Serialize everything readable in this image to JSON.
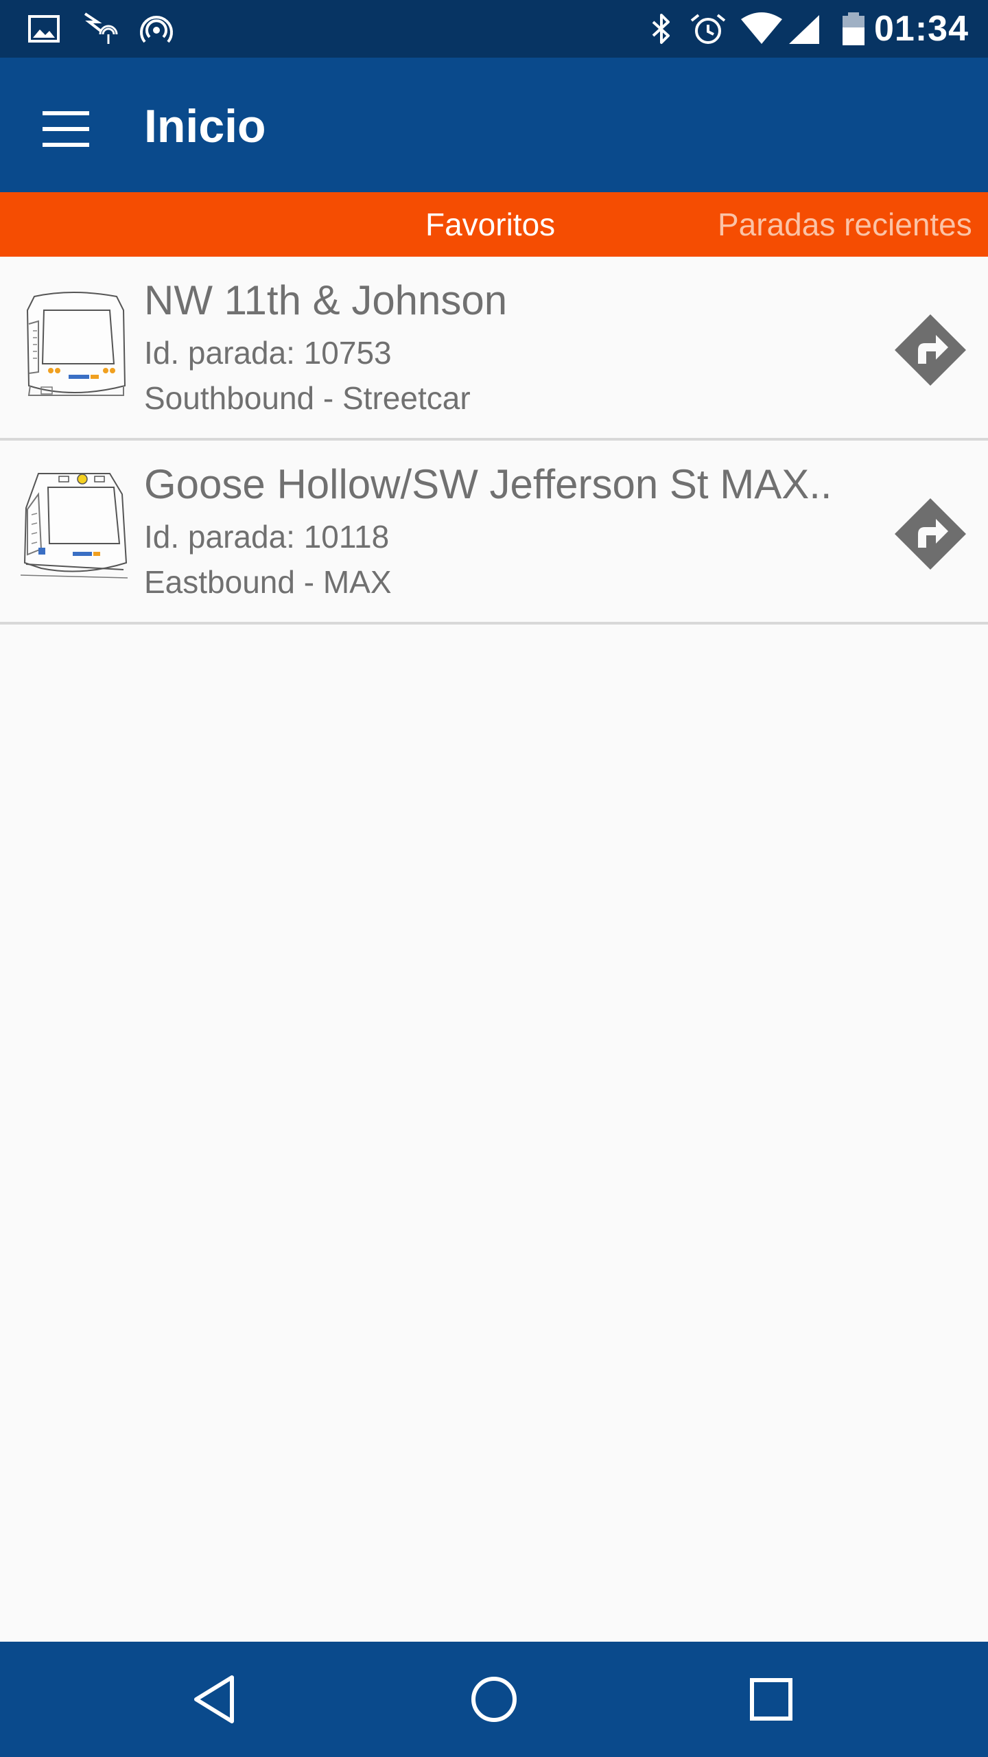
{
  "status_bar": {
    "time": "01:34",
    "left_icons": [
      "image-icon",
      "signal-flash-icon",
      "hotspot-icon"
    ],
    "right_icons": [
      "bluetooth-icon",
      "alarm-icon",
      "wifi-icon",
      "cell-signal-icon",
      "battery-icon"
    ]
  },
  "app_bar": {
    "title": "Inicio",
    "menu_icon": "hamburger-menu-icon"
  },
  "tabs": [
    {
      "label": "Favoritos",
      "selected": true
    },
    {
      "label": "Paradas recientes",
      "selected": false
    }
  ],
  "stops": [
    {
      "title": "NW 11th & Johnson",
      "stop_id": "Id. parada: 10753",
      "direction": "Southbound - Streetcar",
      "thumbnail": "streetcar-icon",
      "action_icon": "directions-icon"
    },
    {
      "title": "Goose Hollow/SW Jefferson St MAX..",
      "stop_id": "Id. parada: 10118",
      "direction": "Eastbound - MAX",
      "thumbnail": "max-train-icon",
      "action_icon": "directions-icon"
    }
  ],
  "nav_bar": {
    "icons": [
      "back-icon",
      "home-icon",
      "recents-icon"
    ]
  },
  "colors": {
    "status_bar": "#073463",
    "app_bar": "#0a4a8c",
    "tab_bar": "#f54d02",
    "tab_selected_text": "#ffffff",
    "tab_unselected_text": "#fbc3a6",
    "list_text": "#707070",
    "divider": "#d8d8d8",
    "background": "#fafafa"
  }
}
